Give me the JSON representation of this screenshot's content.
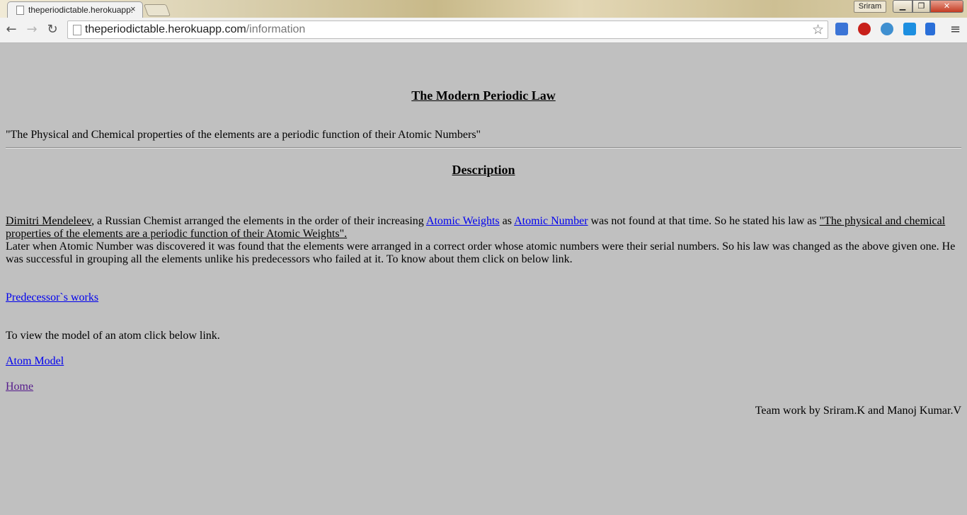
{
  "browser": {
    "tab_title": "theperiodictable.herokuapp.com/information",
    "tab_close": "×",
    "user_name": "Sriram",
    "url_host": "theperiodictable.herokuapp.com",
    "url_path": "/information",
    "min_glyph": "▁",
    "max_glyph": "❐",
    "close_glyph": "✕",
    "back_glyph": "←",
    "fwd_glyph": "→",
    "reload_glyph": "↻",
    "star_glyph": "☆",
    "menu_glyph": "≡",
    "extensions": [
      "keyboard-extension-icon",
      "adblock-extension-icon",
      "globe-extension-icon",
      "screen-extension-icon",
      "megaphone-extension-icon"
    ]
  },
  "page": {
    "heading_law": "The Modern Periodic Law",
    "law_quote": "\"The Physical and Chemical properties of the elements are a periodic function of their Atomic Numbers\"",
    "heading_description": "Description",
    "desc": {
      "mendeleev": "Dimitri Mendeleev",
      "t1": ", a Russian Chemist arranged the elements in the order of their increasing ",
      "link_weights": "Atomic Weights",
      "t2": " as ",
      "link_number": "Atomic Number",
      "t3": " was not found at that time. So he stated his law as ",
      "old_law": "\"The physical and chemical properties of the elements are a periodic function of their Atomic Weights\".",
      "t4": "Later when Atomic Number was discovered it was found that the elements were arranged in a correct order whose atomic numbers were their serial numbers. So his law was changed as the above given one. He was successful in grouping all the elements unlike his predecessors who failed at it. To know about them click on below link."
    },
    "link_predecessors": "Predecessor`s works",
    "atom_text": "To view the model of an atom click below link.",
    "link_atom": "Atom Model",
    "link_home": "Home",
    "credit": "Team work by Sriram.K and Manoj Kumar.V"
  },
  "colors": {
    "page_background": "#c0c0c0",
    "link": "#0000ee",
    "visited_link": "#551a8b"
  }
}
